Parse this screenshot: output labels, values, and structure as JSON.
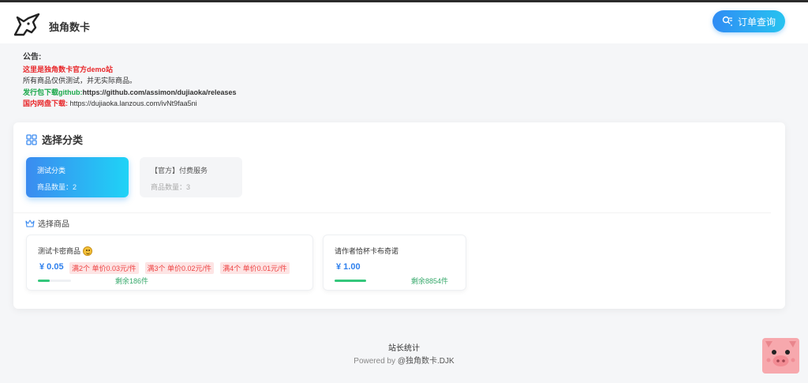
{
  "header": {
    "site_name": "独角数卡",
    "query_button": "订单查询"
  },
  "notice": {
    "title": "公告:",
    "line1": "这里是独角数卡官方demo站",
    "line2": "所有商品仅供测试，并无实际商品。",
    "line3_label": "发行包下载github:",
    "line3_url": "https://github.com/assimon/dujiaoka/releases",
    "line4_label": "国内网盘下载:",
    "line4_url": " https://dujiaoka.lanzous.com/ivNt9faa5ni"
  },
  "categories": {
    "title": "选择分类",
    "items": [
      {
        "name": "测试分类",
        "count": "商品数量：2"
      },
      {
        "name": "【官方】付费服务",
        "count": "商品数量：3"
      }
    ]
  },
  "products": {
    "title": "选择商品",
    "items": [
      {
        "name": "测试卡密商品",
        "price": "¥ 0.05",
        "tags": [
          "满2个 单价0.03元/件",
          "满3个 单价0.02元/件",
          "满4个 单价0.01元/件"
        ],
        "stock": "剩余186件",
        "stock_level": 0.35
      },
      {
        "name": "请作者恰杯卡布奇诺",
        "price": "¥ 1.00",
        "tags": [],
        "stock": "剩余8854件",
        "stock_level": 1.0
      }
    ]
  },
  "footer": {
    "stat": "站长统计",
    "powered_prefix": "Powered by ",
    "powered_brand": "@独角数卡.DJK"
  },
  "colors": {
    "accent_start": "#2f8cf4",
    "accent_end": "#27c3f0",
    "notice_red": "#e8282b",
    "notice_green": "#1aa84a",
    "price_blue": "#2f80ed",
    "stock_green": "#34c77b"
  }
}
